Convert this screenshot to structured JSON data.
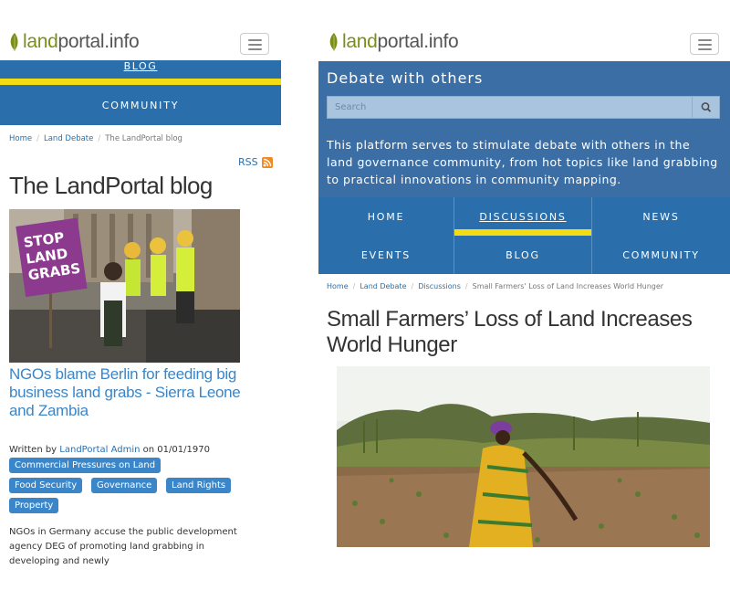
{
  "brand": {
    "logo_prefix": "land",
    "logo_suffix": "portal.info",
    "accent_color": "#7a8f1a",
    "primary_color": "#2a6fac",
    "highlight_color": "#f3dc11"
  },
  "left": {
    "menu": {
      "blog_label": "BLOG",
      "community_label": "COMMUNITY"
    },
    "breadcrumb": [
      "Home",
      "Land Debate",
      "The LandPortal blog"
    ],
    "rss_label": "RSS",
    "page_title": "The LandPortal blog",
    "image": {
      "sign_line1": "STOP",
      "sign_line2": "LAND",
      "sign_line3": "GRABS"
    },
    "post": {
      "title": "NGOs blame Berlin for feeding big business land grabs - Sierra Leone and Zambia",
      "written_by_label": "Written by",
      "author": "LandPortal Admin",
      "date_prefix": "on 01/01/1970",
      "tags": [
        "Commercial Pressures on Land",
        "Food Security",
        "Governance",
        "Land Rights",
        "Property"
      ],
      "excerpt": "NGOs in Germany accuse the public development agency DEG of promoting land grabbing in developing and newly"
    }
  },
  "right": {
    "hero": {
      "title": "Debate with others",
      "search_placeholder": "Search",
      "description": "This platform serves to stimulate debate with others in the land governance community, from hot topics like land grabbing to practical innovations in community mapping."
    },
    "nav": {
      "items": [
        "HOME",
        "DISCUSSIONS",
        "NEWS",
        "EVENTS",
        "BLOG",
        "COMMUNITY"
      ],
      "active": "DISCUSSIONS"
    },
    "breadcrumb": [
      "Home",
      "Land Debate",
      "Discussions",
      "Small Farmers' Loss of Land Increases World Hunger"
    ],
    "page_title": "Small Farmers’ Loss of Land Increases World Hunger",
    "icons": {
      "search": "search-icon",
      "menu": "hamburger-icon",
      "rss": "rss-icon",
      "leaf": "leaf-logo-icon"
    }
  }
}
